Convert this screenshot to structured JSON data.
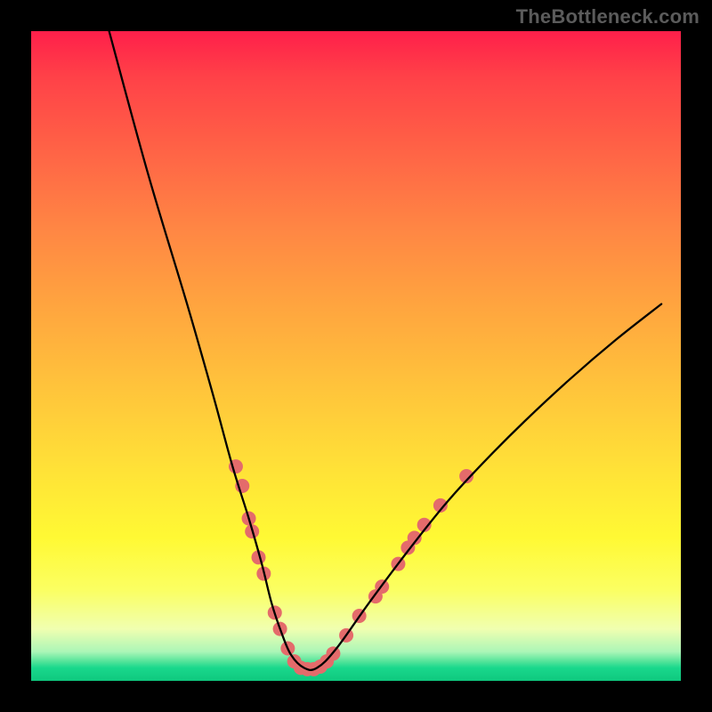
{
  "watermark": "TheBottleneck.com",
  "chart_data": {
    "type": "line",
    "title": "",
    "xlabel": "",
    "ylabel": "",
    "xlim": [
      0,
      100
    ],
    "ylim": [
      0,
      100
    ],
    "background_bands": [
      {
        "y": 100,
        "color": "#ff1f4a"
      },
      {
        "y": 78,
        "color": "#fff934"
      },
      {
        "y": 8,
        "color": "#acf6b7"
      },
      {
        "y": 3,
        "color": "#0fc87e"
      }
    ],
    "series": [
      {
        "name": "curve",
        "color": "#000000",
        "x": [
          12,
          18,
          24,
          28,
          31,
          33.5,
          35.5,
          37,
          38.5,
          40,
          42,
          44,
          47,
          52,
          58,
          64,
          70,
          76,
          83,
          90,
          97
        ],
        "y": [
          100,
          78,
          58,
          44,
          33,
          25,
          18,
          12,
          7.5,
          4,
          2,
          2,
          5,
          12,
          20,
          27.5,
          34,
          40,
          46.5,
          52.5,
          58
        ]
      }
    ],
    "markers": {
      "name": "highlight-points",
      "color": "#e46b6b",
      "radius_px": 8,
      "points": [
        {
          "x": 31.5,
          "y": 33
        },
        {
          "x": 32.5,
          "y": 30
        },
        {
          "x": 33.5,
          "y": 25
        },
        {
          "x": 34.0,
          "y": 23
        },
        {
          "x": 35.0,
          "y": 19
        },
        {
          "x": 35.8,
          "y": 16.5
        },
        {
          "x": 37.5,
          "y": 10.5
        },
        {
          "x": 38.3,
          "y": 8
        },
        {
          "x": 39.5,
          "y": 5
        },
        {
          "x": 40.5,
          "y": 3
        },
        {
          "x": 41.5,
          "y": 2
        },
        {
          "x": 42.5,
          "y": 1.8
        },
        {
          "x": 43.5,
          "y": 1.8
        },
        {
          "x": 44.5,
          "y": 2.2
        },
        {
          "x": 45.5,
          "y": 3
        },
        {
          "x": 46.5,
          "y": 4.2
        },
        {
          "x": 48.5,
          "y": 7
        },
        {
          "x": 50.5,
          "y": 10
        },
        {
          "x": 53.0,
          "y": 13
        },
        {
          "x": 54.0,
          "y": 14.5
        },
        {
          "x": 56.5,
          "y": 18
        },
        {
          "x": 58.0,
          "y": 20.5
        },
        {
          "x": 59.0,
          "y": 22
        },
        {
          "x": 60.5,
          "y": 24
        },
        {
          "x": 63.0,
          "y": 27
        },
        {
          "x": 67.0,
          "y": 31.5
        }
      ]
    }
  }
}
